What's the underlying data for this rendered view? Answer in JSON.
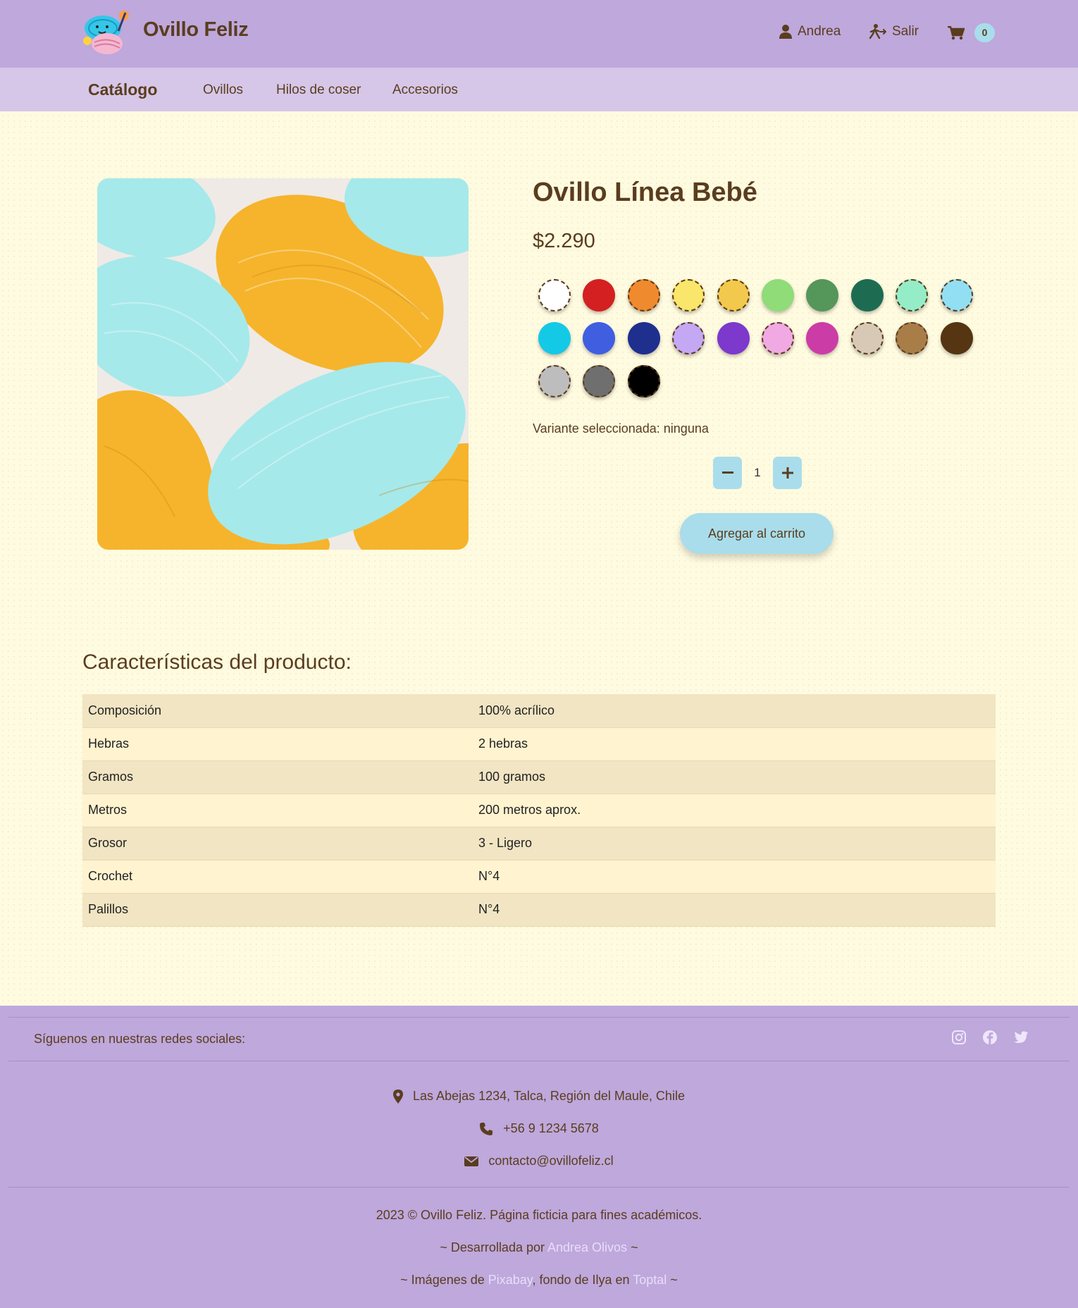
{
  "header": {
    "brand": "Ovillo Feliz",
    "user_name": "Andrea",
    "logout_label": "Salir",
    "cart_count": "0"
  },
  "nav": {
    "title": "Catálogo",
    "links": [
      "Ovillos",
      "Hilos de coser",
      "Accesorios"
    ]
  },
  "product": {
    "title": "Ovillo Línea Bebé",
    "price": "$2.290",
    "variant_text": "Variante seleccionada: ninguna",
    "quantity": "1",
    "add_to_cart_label": "Agregar al carrito",
    "swatch_colors": [
      "#ffffff",
      "#d42020",
      "#f08a2e",
      "#f9e66b",
      "#f2c94c",
      "#8fdc78",
      "#55965a",
      "#1d6c52",
      "#94edc6",
      "#92dff3",
      "#14c9e6",
      "#3f5fe0",
      "#1f2f8e",
      "#c4a8f4",
      "#7d38cc",
      "#f1a9e3",
      "#cc3ca6",
      "#d8c9b6",
      "#a87d48",
      "#553512",
      "#bdbdbd",
      "#6f6f6f",
      "#000000"
    ],
    "image_palette": {
      "turquoise": "#a6e9ea",
      "yellow": "#f6b42c"
    }
  },
  "characteristics": {
    "heading": "Características del producto:",
    "rows": [
      {
        "key": "Composición",
        "value": "100% acrílico"
      },
      {
        "key": "Hebras",
        "value": "2 hebras"
      },
      {
        "key": "Gramos",
        "value": "100 gramos"
      },
      {
        "key": "Metros",
        "value": "200 metros aprox."
      },
      {
        "key": "Grosor",
        "value": "3 - Ligero"
      },
      {
        "key": "Crochet",
        "value": "N°4"
      },
      {
        "key": "Palillos",
        "value": "N°4"
      }
    ]
  },
  "footer": {
    "social_label": "Síguenos en nuestras redes sociales:",
    "social_icons": [
      "instagram-icon",
      "facebook-icon",
      "twitter-icon"
    ],
    "address": "Las Abejas 1234, Talca, Región del Maule, Chile",
    "phone": "+56 9 1234 5678",
    "email": "contacto@ovillofeliz.cl",
    "copyright": "2023 © Ovillo Feliz. Página ficticia para fines académicos.",
    "dev_prefix": "~ Desarrollada por ",
    "dev_name": "Andrea Olivos",
    "dev_suffix": " ~",
    "img_prefix": "~ Imágenes de ",
    "img_source": "Pixabay",
    "img_middle": ", fondo de Ilya en ",
    "bg_source": "Toptal",
    "img_suffix": " ~"
  },
  "colors": {
    "header_bg": "#bea8dc",
    "nav_bg": "#d6c6e8",
    "page_bg": "#fffbe0",
    "accent": "#a9ddeb",
    "text": "#5a3d1e"
  }
}
